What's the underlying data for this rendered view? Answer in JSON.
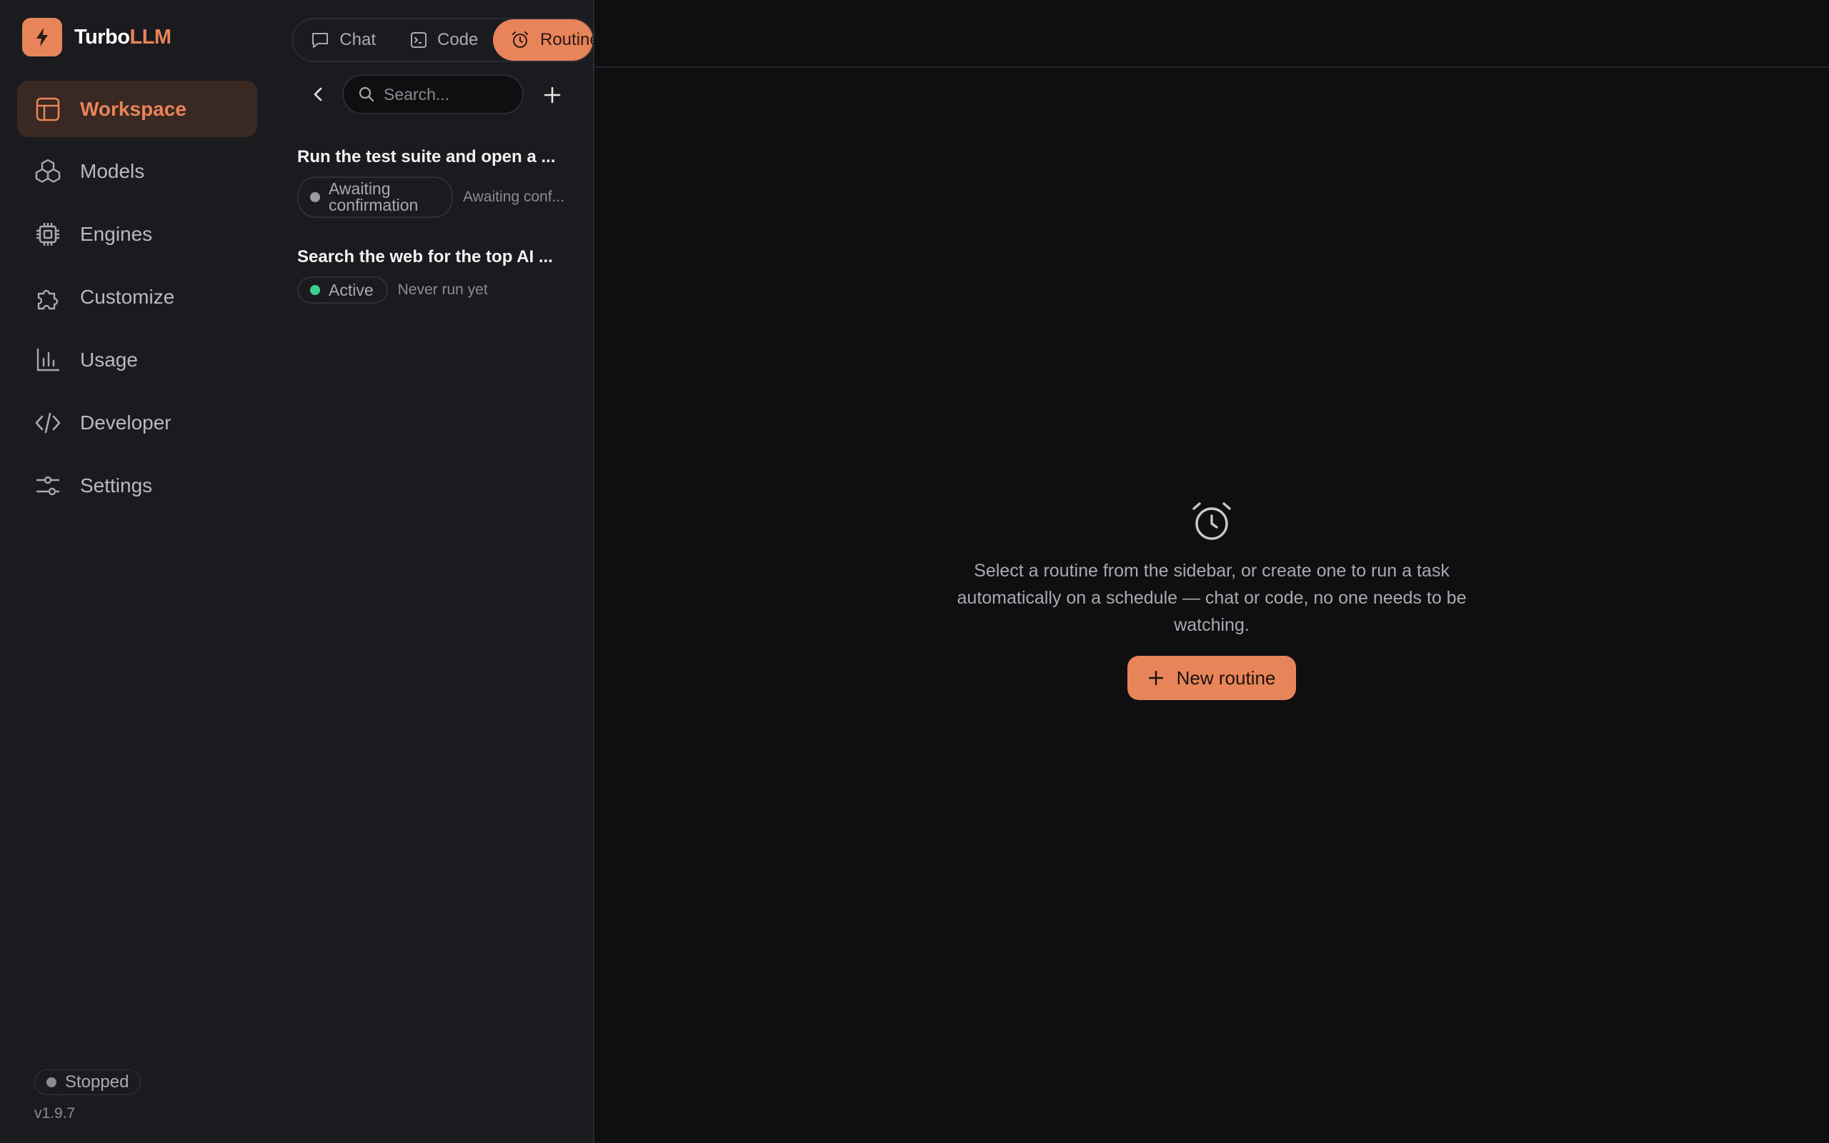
{
  "brand": {
    "name_part1": "Turbo",
    "name_part2": "LLM"
  },
  "nav": {
    "items": [
      {
        "label": "Workspace",
        "icon": "layout-icon",
        "active": true
      },
      {
        "label": "Models",
        "icon": "boxes-icon"
      },
      {
        "label": "Engines",
        "icon": "chip-icon"
      },
      {
        "label": "Customize",
        "icon": "puzzle-icon"
      },
      {
        "label": "Usage",
        "icon": "bar-chart-icon"
      },
      {
        "label": "Developer",
        "icon": "code-icon"
      },
      {
        "label": "Settings",
        "icon": "sliders-icon"
      }
    ],
    "status": "Stopped",
    "version": "v1.9.7"
  },
  "tabs": [
    {
      "label": "Chat",
      "icon": "chat-bubble-icon"
    },
    {
      "label": "Code",
      "icon": "terminal-icon"
    },
    {
      "label": "Routines",
      "icon": "alarm-clock-icon",
      "active": true
    }
  ],
  "search": {
    "placeholder": "Search..."
  },
  "routines": [
    {
      "title": "Run the test suite and open a ...",
      "status": "Awaiting confirmation",
      "status_color": "#9a9aa0",
      "meta": "Awaiting conf..."
    },
    {
      "title": "Search the web for the top AI ...",
      "status": "Active",
      "status_color": "#3ecf8e",
      "meta": "Never run yet"
    }
  ],
  "empty_state": {
    "text": "Select a routine from the sidebar, or create one to run a task automatically on a schedule — chat or code, no one needs to be watching.",
    "button": "New routine"
  },
  "colors": {
    "accent": "#e8845a",
    "active_green": "#3ecf8e"
  }
}
